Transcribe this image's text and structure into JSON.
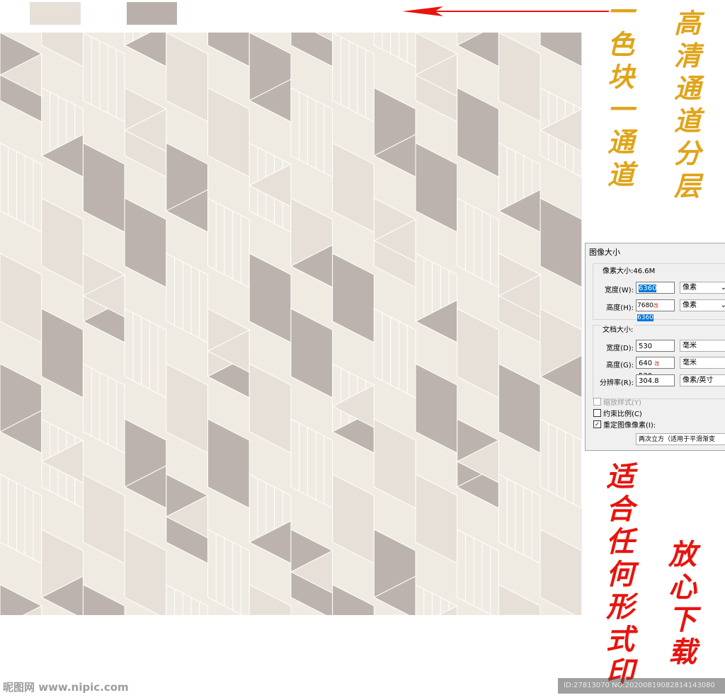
{
  "swatches": {
    "light": "#e6e0d8",
    "dark": "#b9b0ab"
  },
  "arrow_color": "#e8140e",
  "pattern_colors": {
    "cream": "#efebe3",
    "light": "#e6e0d8",
    "dark": "#bcb3ae",
    "line": "#ffffff"
  },
  "texts": {
    "one_color_one_channel": [
      "一",
      "色",
      "块",
      "一",
      "通",
      "道"
    ],
    "hd_channel_layers": [
      "高",
      "清",
      "通",
      "道",
      "分",
      "层"
    ],
    "suitable_print": [
      "适",
      "合",
      "任",
      "何",
      "形",
      "式",
      "印"
    ],
    "download_safe": [
      "放",
      "心",
      "下",
      "载"
    ]
  },
  "dialog": {
    "title": "图像大小",
    "pixel_group": "像素大小:46.6M",
    "width_label": "宽度(W):",
    "width_value": "6360",
    "width_unit": "像素",
    "height_label": "高度(H):",
    "height_old": "7680",
    "height_mark": "改",
    "height_value": "6360",
    "height_unit": "像素",
    "doc_group": "文档大小:",
    "doc_width_label": "宽度(D):",
    "doc_width_value": "530",
    "doc_width_unit": "毫米",
    "doc_height_label": "高度(G):",
    "doc_height_old": "640",
    "doc_height_mark": "改",
    "doc_height_value": "530",
    "doc_height_unit": "毫米",
    "resolution_label": "分辨率(R):",
    "resolution_value": "304.8",
    "resolution_unit": "像素/英寸",
    "scale_styles": "缩放样式(Y)",
    "constrain": "约束比例(C)",
    "resample": "重定图像像素(I):",
    "resample_method": "两次立方（适用于平滑渐变"
  },
  "watermark": {
    "site": "昵图网 www.nipic.com",
    "id": "ID:27813070 NO:20200819082814143080"
  }
}
